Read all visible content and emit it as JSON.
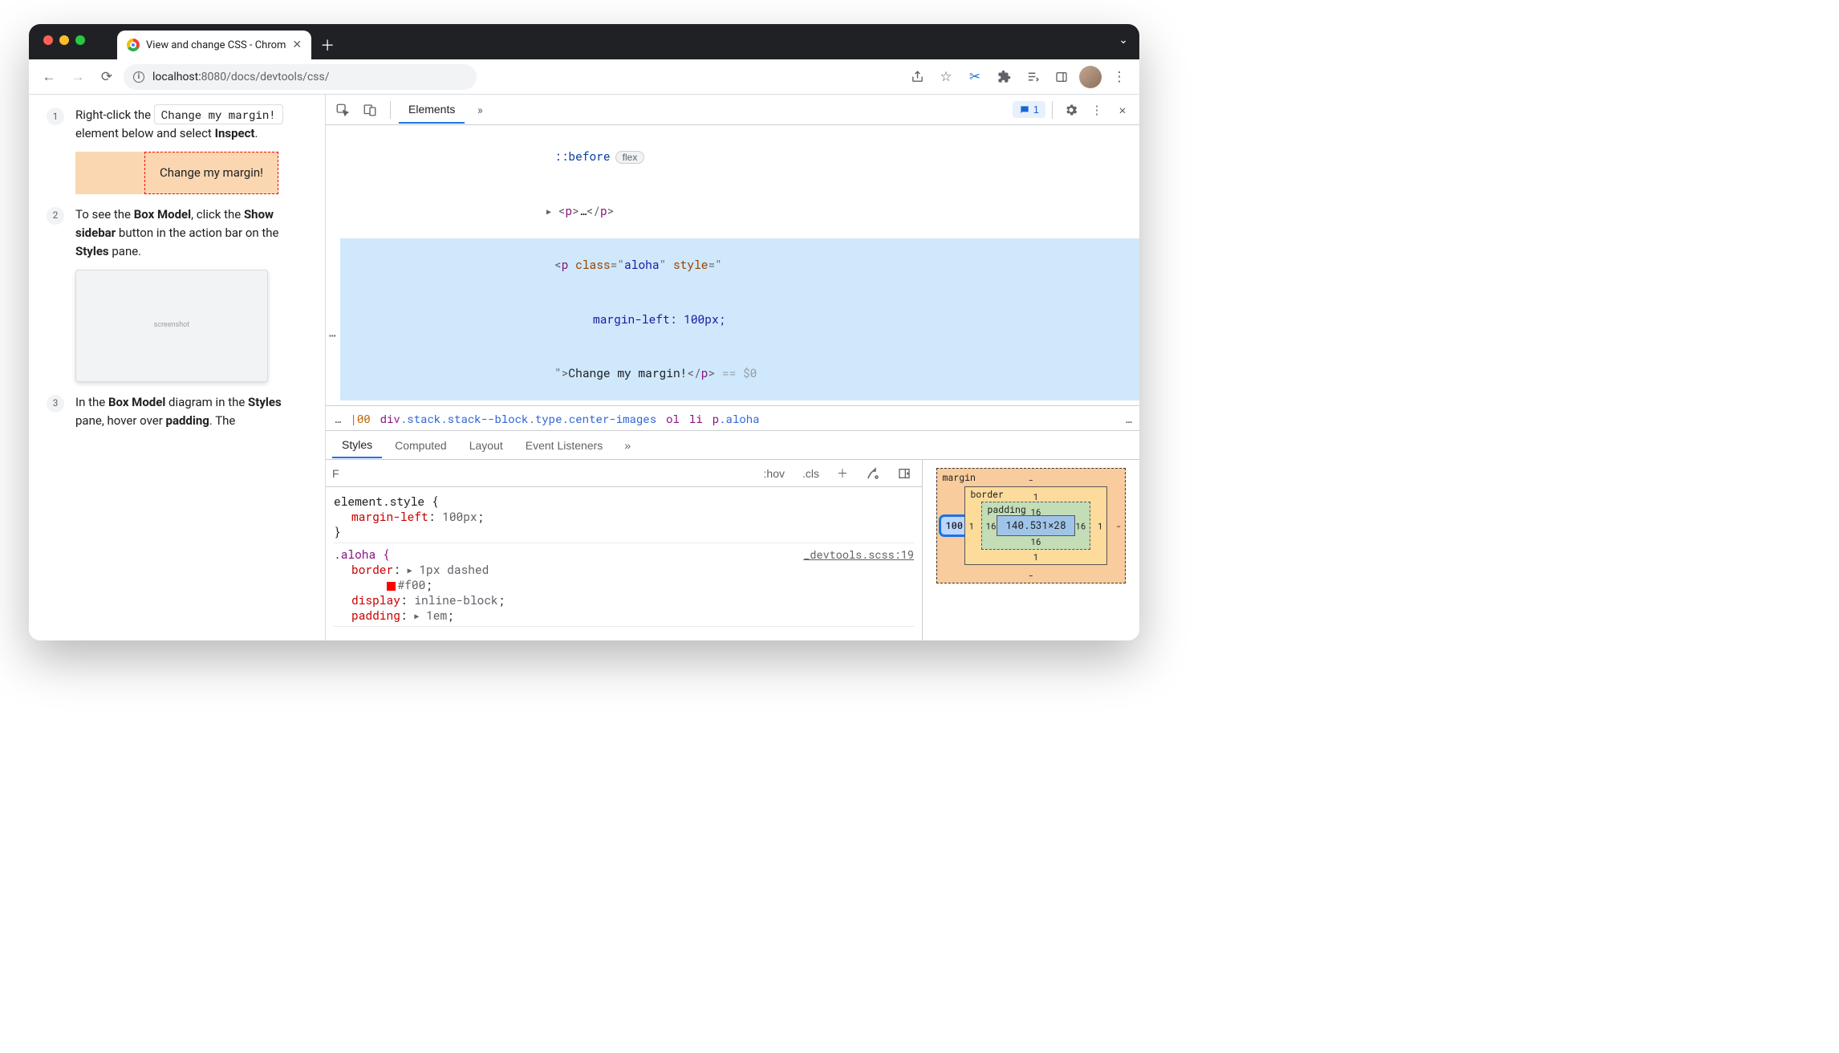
{
  "tab": {
    "title": "View and change CSS - Chrom"
  },
  "omnibox": {
    "host": "localhost:",
    "port": "8080",
    "path": "/docs/devtools/css/"
  },
  "doc": {
    "step1_prefix": "Right-click the ",
    "step1_pill": "Change my margin!",
    "step1_suffix": " element below and select ",
    "step1_bold": "Inspect",
    "demo_text": "Change my margin!",
    "step2_a": "To see the ",
    "step2_b": "Box Model",
    "step2_c": ", click the ",
    "step2_d": "Show sidebar",
    "step2_e": " button in the action bar on the ",
    "step2_f": "Styles",
    "step2_g": " pane.",
    "step3_a": "In the ",
    "step3_b": "Box Model",
    "step3_c": " diagram in the ",
    "step3_d": "Styles",
    "step3_e": " pane, hover over ",
    "step3_f": "padding",
    "step3_g": ". The"
  },
  "devtools": {
    "tab_elements": "Elements",
    "msg_count": "1",
    "dom": {
      "before": "::before",
      "flex": "flex",
      "p_collapsed": "<p>…</p>",
      "sel_open": "<p class=\"aloha\" style=\"",
      "sel_line2": "margin-left: 100px;",
      "sel_close": "\">Change my margin!</p>",
      "eq0": " == $0"
    },
    "crumbs": {
      "dots": "…",
      "x": "00",
      "main": "div.stack.stack--block.type.center-images",
      "ol": "ol",
      "li": "li",
      "leaf": "p.aloha"
    },
    "styles_tabs": {
      "styles": "Styles",
      "computed": "Computed",
      "layout": "Layout",
      "evt": "Event Listeners"
    },
    "toolbar": {
      "filter": "F",
      "hov": ":hov",
      "cls": ".cls"
    },
    "rules": {
      "el_style": "element.style {",
      "el_decl_prop": "margin-left",
      "el_decl_val": "100px",
      "close": "}",
      "aloha_sel": ".aloha {",
      "aloha_src": "_devtools.scss:19",
      "border_prop": "border",
      "border_val": "1px dashed",
      "border_color": "#f00",
      "display_prop": "display",
      "display_val": "inline-block",
      "padding_prop": "padding",
      "padding_val": "1em"
    },
    "box": {
      "m_label": "margin",
      "b_label": "border",
      "p_label": "padding",
      "content": "140.531×28",
      "p_t": "16",
      "p_r": "16",
      "p_b": "16",
      "p_l": "16",
      "b_t": "1",
      "b_r": "1",
      "b_b": "1",
      "b_l": "1",
      "m_t": "-",
      "m_r": "-",
      "m_b": "-",
      "m_l": "100"
    }
  }
}
